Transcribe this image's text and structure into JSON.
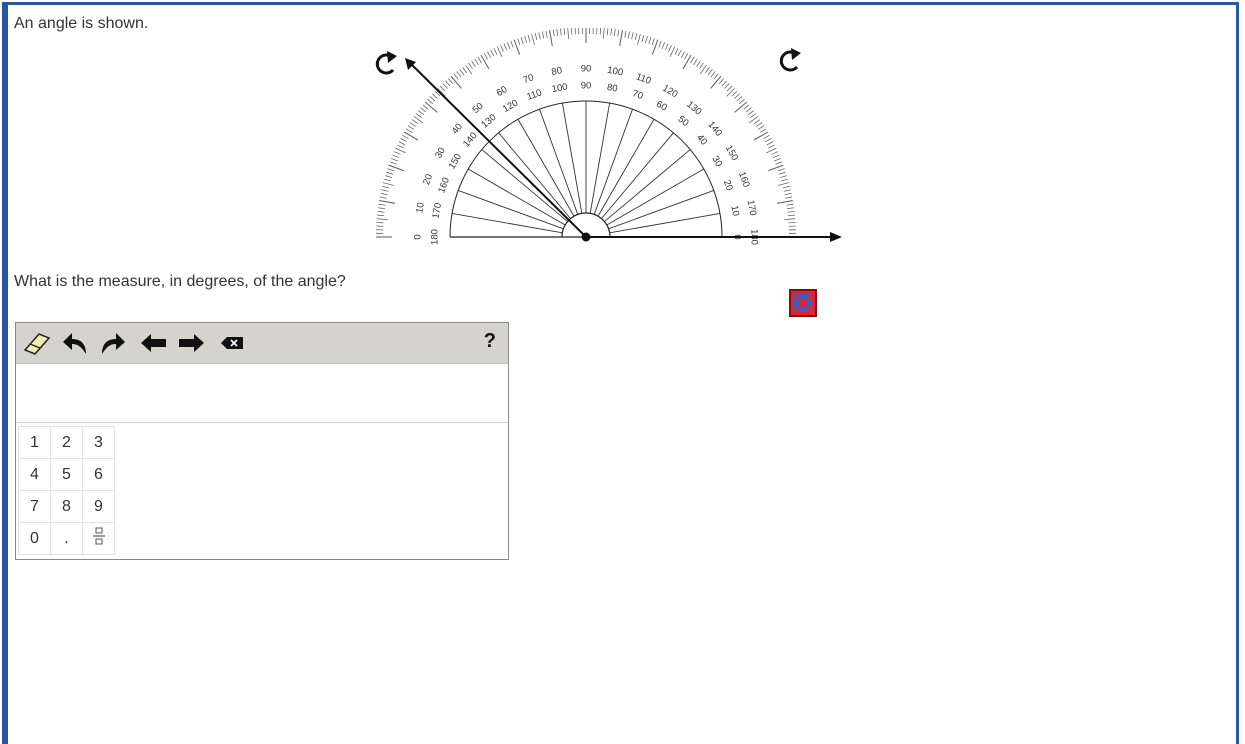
{
  "prompt": "An angle is shown.",
  "question": "What is the measure, in degrees, of the angle?",
  "protractor": {
    "outer_labels": [
      "0",
      "10",
      "20",
      "30",
      "40",
      "50",
      "60",
      "70",
      "80",
      "90",
      "100",
      "110",
      "120",
      "130",
      "140",
      "150",
      "160",
      "170",
      "180"
    ],
    "inner_labels": [
      "180",
      "170",
      "160",
      "150",
      "140",
      "130",
      "120",
      "110",
      "100",
      "90",
      "80",
      "70",
      "60",
      "50",
      "40",
      "30",
      "20",
      "10",
      "0"
    ]
  },
  "toolbar": {
    "help_label": "?",
    "tools": [
      "eraser-icon",
      "undo-icon",
      "redo-icon",
      "left-arrow-icon",
      "right-arrow-icon",
      "backspace-icon"
    ]
  },
  "answer": {
    "value": ""
  },
  "keypad": {
    "rows": [
      [
        "1",
        "2",
        "3"
      ],
      [
        "4",
        "5",
        "6"
      ],
      [
        "7",
        "8",
        "9"
      ],
      [
        "0",
        ".",
        "fraction"
      ]
    ]
  },
  "colors": {
    "border": "#2857a5",
    "toolbar": "#d6d3ce",
    "close_red": "#f01e1e",
    "close_blue": "#2a63d6"
  }
}
